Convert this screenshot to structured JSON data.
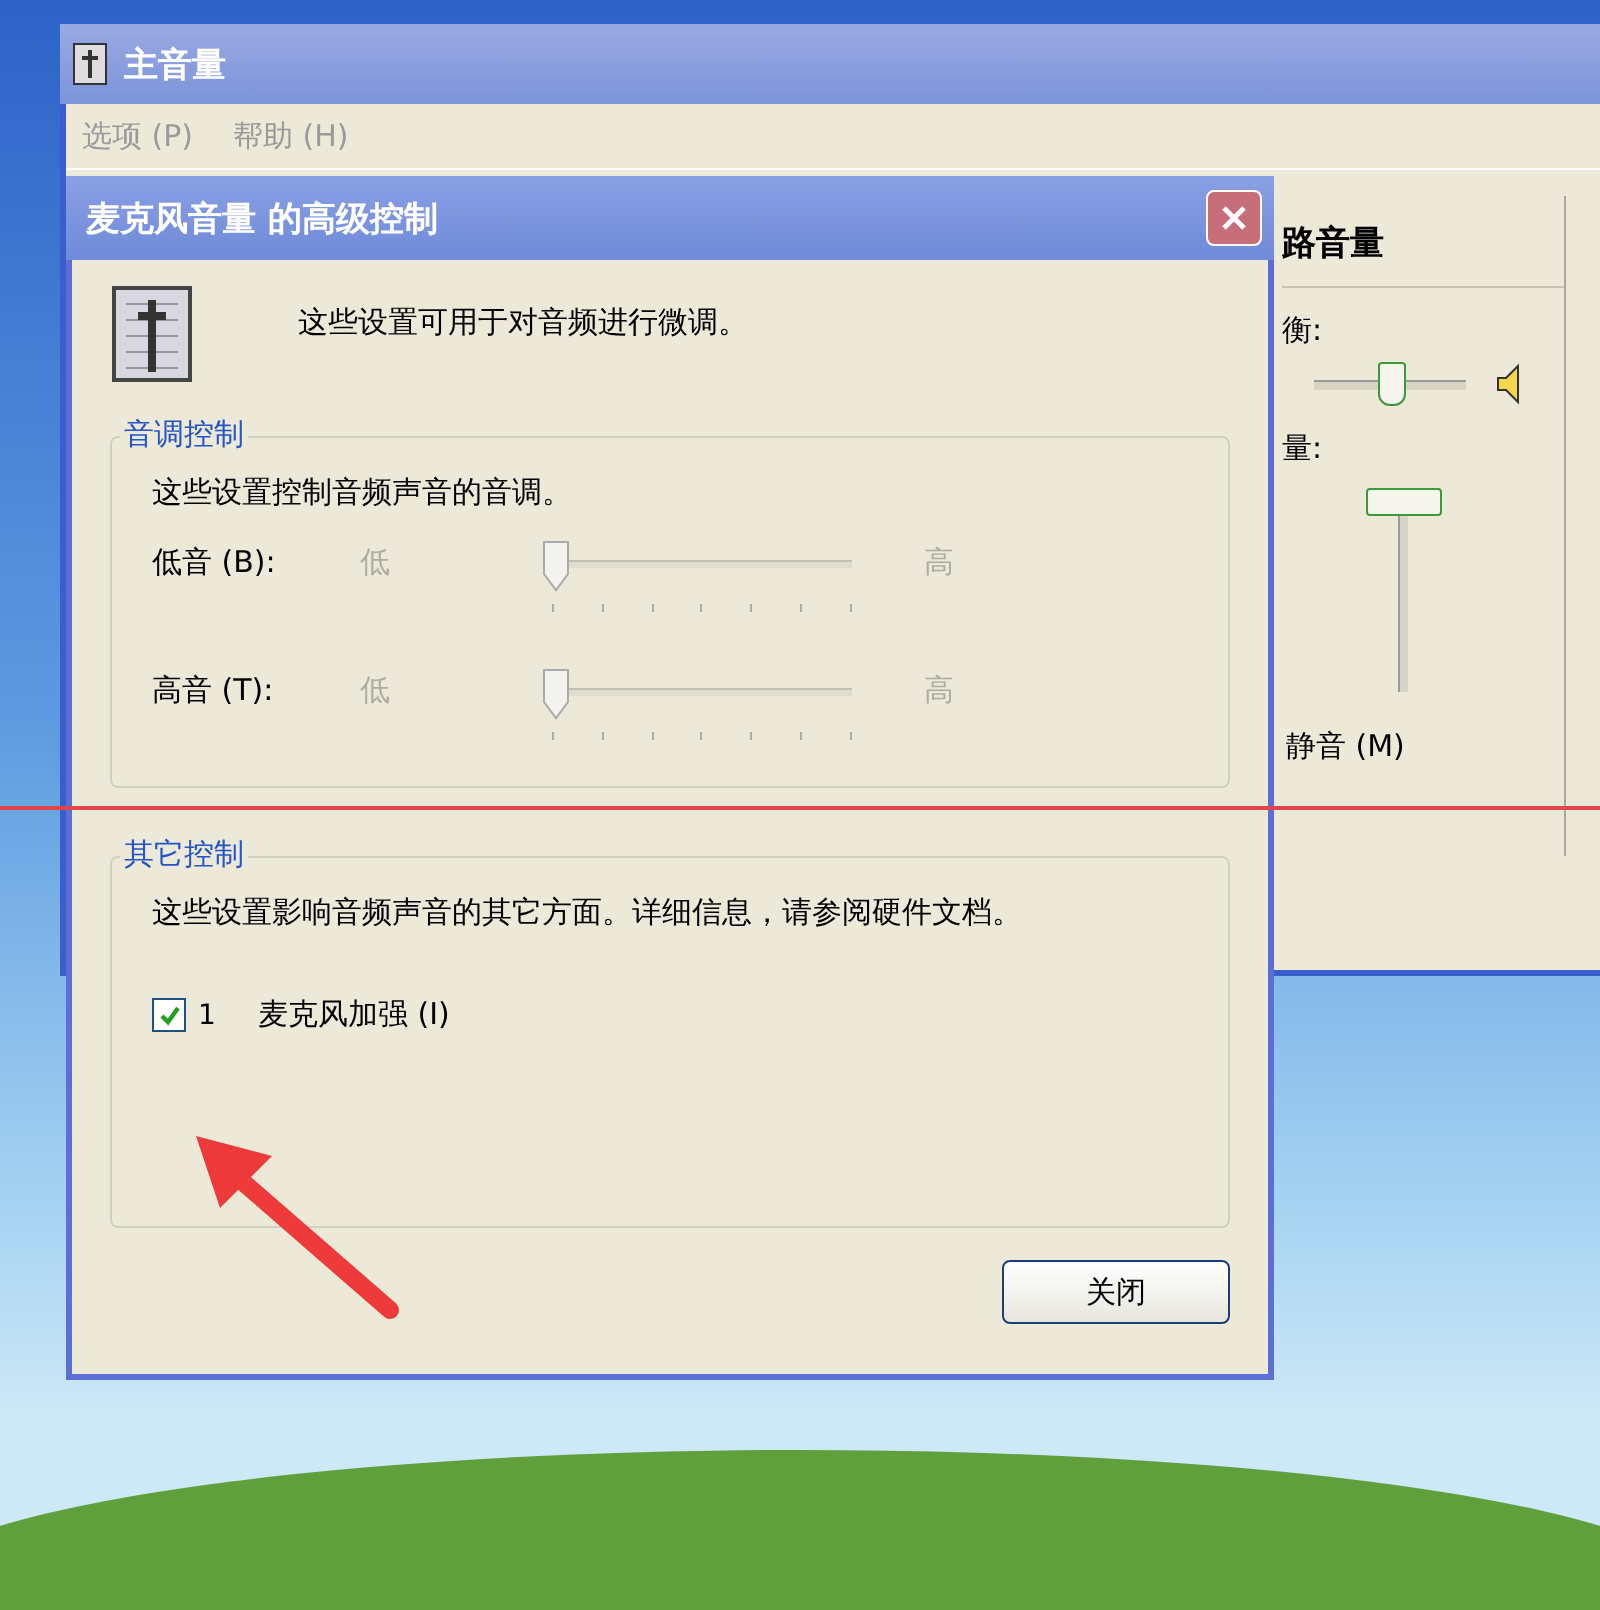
{
  "main_window": {
    "title": "主音量",
    "menu": [
      {
        "label": "选项 (P)",
        "disabled": true
      },
      {
        "label": "帮助 (H)",
        "disabled": true
      }
    ],
    "channel": {
      "title": "路音量",
      "balance_label": "衡:",
      "balance": {
        "level": 0.5
      },
      "volume_label": "量:",
      "volume": {
        "level": 1
      },
      "mute_label": "静音 (M)"
    }
  },
  "dialog": {
    "title": "麦克风音量 的高级控制",
    "intro": "这些设置可用于对音频进行微调。",
    "tone_group": {
      "title": "音调控制",
      "description": "这些设置控制音频声音的音调。",
      "sliders": [
        {
          "label": "低音 (B):",
          "low": "低",
          "high": "高",
          "level": 0,
          "disabled": true
        },
        {
          "label": "高音 (T):",
          "low": "低",
          "high": "高",
          "level": 0,
          "disabled": true
        }
      ]
    },
    "other_group": {
      "title": "其它控制",
      "description": "这些设置影响音频声音的其它方面。详细信息，请参阅硬件文档。",
      "options": [
        {
          "number": "1",
          "label": "麦克风加强 (I)",
          "checked": true
        }
      ]
    },
    "buttons": [
      {
        "label": "关闭"
      }
    ]
  }
}
